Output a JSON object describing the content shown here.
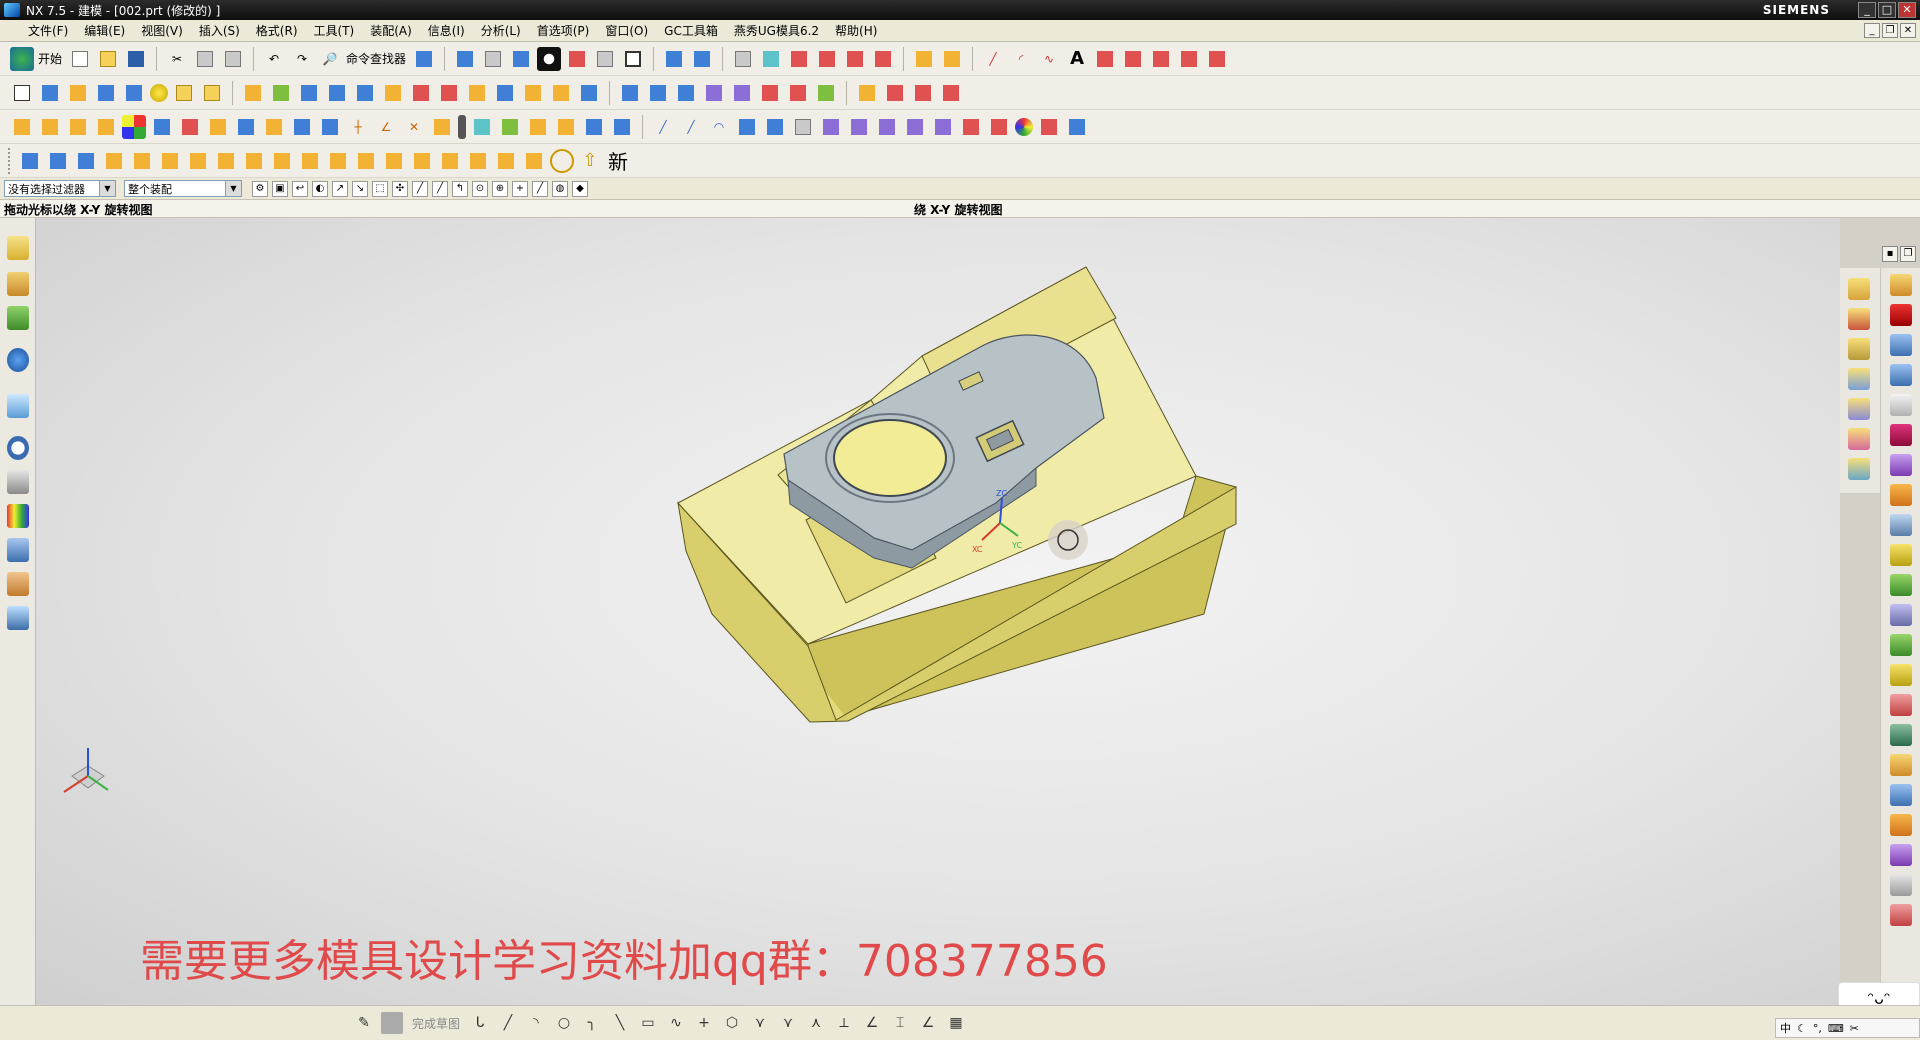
{
  "window": {
    "title": "NX 7.5 - 建模 - [002.prt (修改的) ]",
    "brand": "SIEMENS"
  },
  "menu": {
    "items": [
      "文件(F)",
      "编辑(E)",
      "视图(V)",
      "插入(S)",
      "格式(R)",
      "工具(T)",
      "装配(A)",
      "信息(I)",
      "分析(L)",
      "首选项(P)",
      "窗口(O)",
      "GC工具箱",
      "燕秀UG模具6.2",
      "帮助(H)"
    ]
  },
  "toolbar": {
    "start_label": "开始",
    "command_finder_label": "命令查找器",
    "new_label": "新"
  },
  "filter": {
    "type_filter": "没有选择过滤器",
    "scope": "整个装配"
  },
  "cue": {
    "left": "拖动光标以绕 X-Y 旋转视图",
    "middle": "绕 X-Y 旋转视图"
  },
  "viewport": {
    "promo_text": "需要更多模具设计学习资料加qq群：708377856",
    "csys_labels": [
      "ZC",
      "XC",
      "YC"
    ],
    "colors": {
      "block": "#efe9a0",
      "part": "#aab7bd",
      "background": "#e4e4e4"
    }
  },
  "bottom": {
    "finish_sketch": "完成草图"
  },
  "ime": {
    "mode": "中"
  },
  "icons": [
    "start-icon",
    "new-icon",
    "open-icon",
    "save-icon",
    "cut-icon",
    "copy-icon",
    "paste-icon",
    "undo-icon",
    "redo-icon",
    "command-finder-icon",
    "view-fit-icon",
    "shaded-icon",
    "orient-icon",
    "sketch-icon",
    "extrude-icon",
    "revolve-icon",
    "hole-icon",
    "block-icon",
    "cylinder-icon",
    "sphere-icon",
    "text-icon",
    "arc-icon",
    "line-icon",
    "rectangle-icon",
    "circle-icon",
    "point-icon"
  ]
}
